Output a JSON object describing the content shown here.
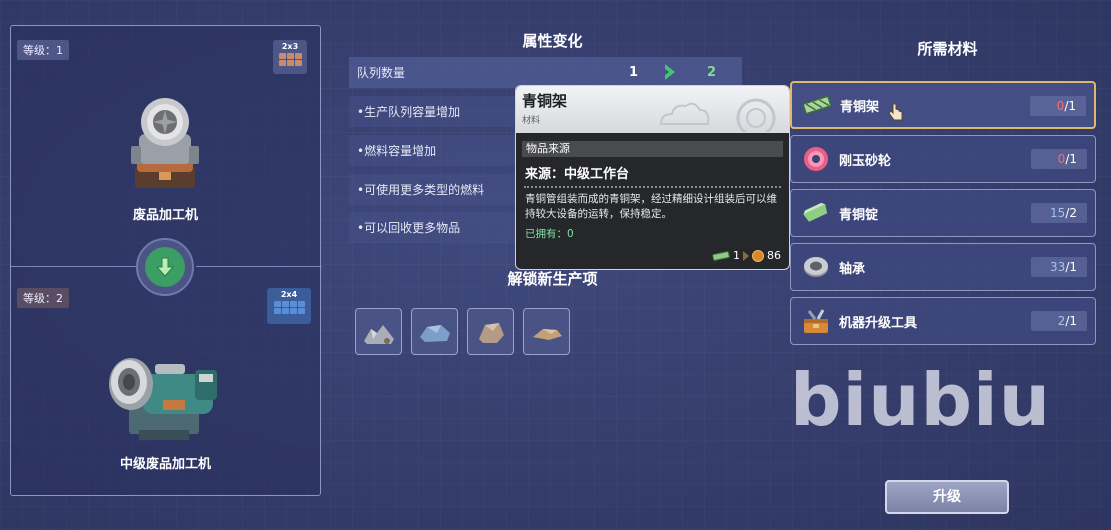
{
  "left_panel": {
    "current": {
      "level": "等级：1",
      "size": "2x3",
      "name": "废品加工机"
    },
    "next": {
      "level": "等级：2",
      "size": "2x4",
      "name": "中级废品加工机"
    }
  },
  "attributes": {
    "title": "属性变化",
    "rows": [
      {
        "label": "队列数量",
        "old": "1",
        "new": "2"
      },
      {
        "label": "•生产队列容量增加"
      },
      {
        "label": "•燃料容量增加"
      },
      {
        "label": "•可使用更多类型的燃料"
      },
      {
        "label": "•可以回收更多物品"
      }
    ]
  },
  "unlock": {
    "title": "解锁新生产项",
    "items": [
      "ore-pile-icon",
      "rock-slab-icon",
      "stone-chunk-icon",
      "flat-scrap-icon"
    ]
  },
  "tooltip": {
    "name": "青铜架",
    "category": "材料",
    "source_header": "物品来源",
    "source": "来源：中级工作台",
    "description": "青铜管组装而成的青铜架，经过精细设计组装后可以维持较大设备的运转，保持稳定。",
    "owned": "已拥有：0",
    "sell_count": "1",
    "price": "86"
  },
  "required": {
    "title": "所需材料",
    "items": [
      {
        "name": "青铜架",
        "have": "0",
        "need": "/1",
        "icon": "bronze-frame-icon",
        "status": "low"
      },
      {
        "name": "刚玉砂轮",
        "have": "0",
        "need": "/1",
        "icon": "grinding-wheel-icon",
        "status": "low"
      },
      {
        "name": "青铜锭",
        "have": "15",
        "need": "/2",
        "icon": "bronze-ingot-icon",
        "status": "ok"
      },
      {
        "name": "轴承",
        "have": "33",
        "need": "/1",
        "icon": "bearing-icon",
        "status": "ok"
      },
      {
        "name": "机器升级工具",
        "have": "2",
        "need": "/1",
        "icon": "toolbox-icon",
        "status": "ok"
      }
    ]
  },
  "watermark": "biubiu",
  "upgrade_button": "升级"
}
